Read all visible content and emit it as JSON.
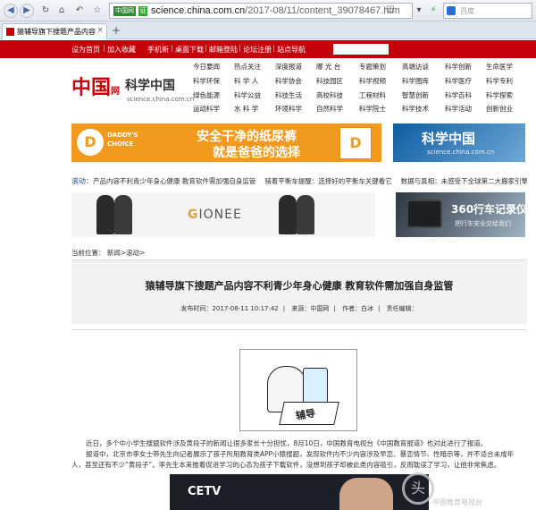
{
  "browser": {
    "url_site_tag": "中国网",
    "url_badge": "证",
    "url_host": "science.china.com.cn",
    "url_path": "/2017-08/11/content_39078467.htm",
    "search_placeholder": "百度",
    "tab_title": "猿辅导旗下搜题产品内容不",
    "tab_close": "×",
    "new_tab": "+"
  },
  "topbar": {
    "items": [
      "设为首页",
      "加入收藏",
      "手机新",
      "桌面下载",
      "邮箱登陆",
      "论坛注册",
      "站点导航"
    ]
  },
  "logo": {
    "main": "中国",
    "small": "网",
    "sub": "科学中国",
    "url": "science.china.com.cn"
  },
  "nav": {
    "rows": [
      [
        "今日要闻",
        "热点关注",
        "深度报道",
        "曝 光 台",
        "专题策划",
        "高端访谈",
        "科学创新",
        "生命医学"
      ],
      [
        "科学环保",
        "科 学 人",
        "科学协会",
        "科技园区",
        "科学视频",
        "科学图库",
        "科学医疗",
        "科学专利"
      ],
      [
        "绿色能源",
        "科学公益",
        "科技生活",
        "高校科技",
        "工程材料",
        "智慧创新",
        "科学百科",
        "科学探索"
      ],
      [
        "运动科学",
        "水 科 学",
        "环境科学",
        "自然科学",
        "科学院士",
        "科学技术",
        "科学活动",
        "创新创业"
      ]
    ]
  },
  "ads": {
    "ad1_logo": "D",
    "ad1_brand": "DADDY'S CHOICE",
    "ad1_slogan1": "安全干净的纸尿裤",
    "ad1_slogan2": "就是爸爸的选择",
    "ad1_pack": "D",
    "ad2_title": "科学中国",
    "ad2_url": "science.china.com.cn",
    "ad3_brand_g": "G",
    "ad3_brand_rest": "IONEE",
    "ad4_title": "360行车记录仪",
    "ad4_sub": "把行车安全交给我们"
  },
  "ticker": {
    "label": "滚动：",
    "text": "产品内容不利青少年身心健康 教育软件需加强自身监管　 骑着平衡车提醒：选择好的平衡车关键看它　 数据与真相：未感受下全球第二大搬家引擎的实力"
  },
  "breadcrumb": "当前位置： 新闻>滚动>",
  "article": {
    "title": "猿辅导旗下搜题产品内容不利青少年身心健康 教育软件需加强自身监管",
    "published": "发布时间：2017-08-11 10:17:42",
    "source": "来源：中国网",
    "author": "作者：白冰",
    "editor": "责任编辑：",
    "illus_label": "辅导",
    "p1": "近日，多个中小学生搜题软件涉及黄段子的新闻让很多家长十分担忧，8月10日，中国教育电视台《中国教育报道》也对此进行了报道。",
    "p2": "报道中，北京市李女士带先生向记者展示了孩子所用教育类APP小猿搜题，发现软件内不少内容涉及早恋、暴恋情节、性暗示等，并不适合未成年人，甚至还有不少“黄段子”。李先生本来推着促进学习的心态为孩子下载软件，没想到孩子却被此类内容吸引，反而耽误了学习，让他非常焦虑。"
  },
  "video": {
    "logo": "CETV"
  },
  "watermark": {
    "glyph": "头",
    "text": "中国教育电视台"
  }
}
